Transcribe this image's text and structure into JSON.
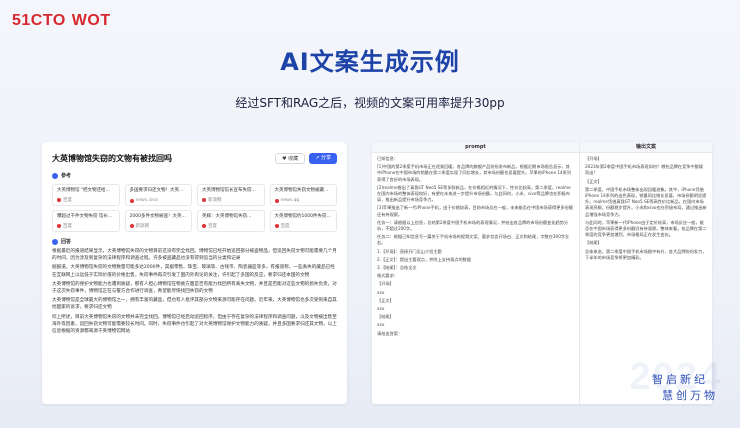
{
  "header": {
    "brand": "51CTO",
    "brand_event": "WOT"
  },
  "slide": {
    "title": "AI文案生成示例",
    "subtitle": "经过SFT和RAG之后，视频的文案可用率提升30pp"
  },
  "qa_card": {
    "question": "大英博物馆失窃的文物有被找回吗",
    "fav_label": "♥ 收藏",
    "share_label": "↗ 分享",
    "reference_label": "参考",
    "references": [
      {
        "title": "大英博物馆 \"把文物还给…",
        "source": "百度"
      },
      {
        "title": "多国要求归还文物！大英…",
        "source": "news.sina"
      },
      {
        "title": "大英博物馆馆长宣布失窃…",
        "source": "新浪网"
      },
      {
        "title": "大英博物馆失窃文物被藏…",
        "source": "news.qq"
      },
      {
        "title": "曝超过千件文物失窃 馆长…",
        "source": "百度"
      },
      {
        "title": "2000多件文物被盗！大英…",
        "source": "新浪网"
      },
      {
        "title": "英媒：大英博物馆失窃…",
        "source": "百度"
      },
      {
        "title": "大英博物馆约1000件失窃…",
        "source": "百度"
      }
    ],
    "answer_label": "回答",
    "answer_paragraphs": [
      "根据最近的报道结果显示，大英博物馆失窃的文物目前还没有完全找回。博物馆已经开始追回部分被盗物品，但追回失窃文物可能需要几个月的时间，因为涉及到复杂的法律程序和调查过程。许多被盗藏品也没有得到追当的分类和记录",
      "据报道，大英博物馆失窃的文物数量可能多达2000件，其据零售、珠宝、玻璃等、古钱币、陶瓷器皿等多，有报道称，一些丢失的藏品已经在互联网上以远低于实际价值的价格出售，失窃事件再次引发了国内外舆论的关注，许引起了多国的反应，要求归还本国的文物",
      "大英博物馆的保护文物能力也遭到质疑，那有人担心博物馆在物质方面是否有能力找回所有丢失文物，并且是否能对这些文物的损失负责。对于这次失窃事件，博物馆正在与警方合作进行调查，希望能尽快找回失窃的文物",
      "大英博物馆是全球最大的博物馆之一，拥有丰富的藏品，但也有人批评其部分文物来源可能存在问题。近年来，大英博物馆也多次受到来自其他国家的诉求，要求归还文物",
      "综上所述，目前大英博物馆失窃的文物并未完全找回。博物馆已经启动追回程序，但由于存在复杂的法律程序和调查问题，以及文物被出售至海外等因素，追回失窃文物可能需要较长时间。同时，失窃事件也引起了对大英博物馆保护文物能力的质疑，并且多国要求归还其文物，以上信息根据的资源都来源于英博物馆网站"
    ]
  },
  "prompt_card": {
    "prompt_header": "prompt",
    "output_header": "输出文案",
    "prompt_paragraphs": [
      "已知信息：",
      "[1]中国的第2季度手机市场正在逐渐回暖，各品牌的旗舰产品纷纷发布新品，根据近期市场报告显示，其中iPhone在中国市场的销量在第二季度实现了同比增长，其市场份额也显著提升。苹果的iPhone 14系列获得了良好的市场表现。",
      "[2]realme推出了真我GT Neo5 SE等多款新品，在价格相近的情况下，性价比较高，第二季度，realme在国内市场的整体表现较好，有望在未来进一步提升市场份额。与此同时，小米、vivo等品牌也在积极布局，推出新品提升市场竞争力。",
      "[3]苹果推出了新一代iPhone手机，由于价格较高，目前市场反应一般，未来能否在中国市场获得更多份额还有待观察。",
      "任务一：请根据以上信息，总结第2季度中国手机市场的表现情况，并给出各品牌的市场份额变化趋势分析，不超过200字。",
      "任务二：根据已知信息写一篇关于手机市场的视频文案，要求包含开场白、正文和结尾，字数在300字左右。",
      "1.【开场】：直接开门见山介绍主题",
      "2.【正文】：提出主要观点，并附上支持观点的数据",
      "3.【结尾】：总结全文",
      "格式要求：",
      "【开场】",
      "xxx",
      "【正文】",
      "xxx",
      "【结尾】",
      "xxx",
      "请给出答案："
    ],
    "output_paragraphs": [
      "【开场】",
      "2023年第2季度中国手机市场表现如何？哪些品牌在竞争中脱颖而出？",
      "【正文】",
      "第二季度，中国手机市场整体出现回暖迹象。其中，iPhone凭借iPhone 14系列的出色表现，销量同比增长显著，市场份额明显提升。realme凭借真我GT Neo5 SE等高性价比新品，在国内市场表现亮眼，份额稳步提升。小米和vivo也在积极布局，通过推出新品增强市场竞争力。",
      "与此同时，苹果新一代iPhone由于定价较高，市场反应一般，能否在中国市场获得更多份额仍有待观察。整体来看，各品牌在第二季度的竞争更加激烈，市场格局正在发生变化。",
      "【结尾】",
      "总体来说，第二季度中国手机市场稳中有升，各大品牌纷纷发力，下半年的市场竞争将更加精彩。"
    ]
  },
  "slogan": {
    "line1": "智启新纪",
    "line2": "慧创万物",
    "watermark": "2024"
  }
}
